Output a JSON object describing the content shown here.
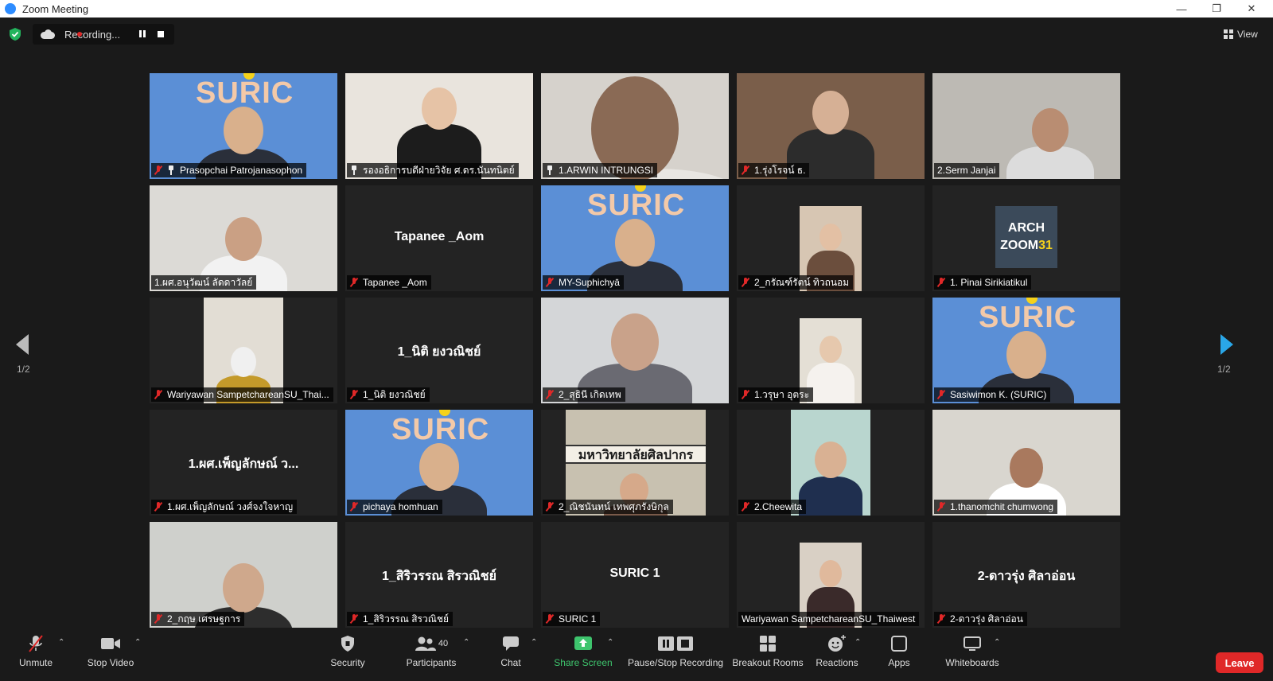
{
  "window": {
    "title": "Zoom Meeting"
  },
  "recording": {
    "status": "Recording..."
  },
  "view": {
    "label": "View"
  },
  "pagination": {
    "left": "1/2",
    "right": "1/2"
  },
  "tiles": [
    {
      "name": "Prasopchai Patrojanasophon",
      "muted": true,
      "pinned": true,
      "video": "suric"
    },
    {
      "name": "รองอธิการบดีฝ่ายวิจัย ศ.ดร.นันทนิตย์",
      "muted": false,
      "pinned": true,
      "video": "woman-light"
    },
    {
      "name": "1.ARWIN INTRUNGSI",
      "muted": false,
      "pinned": true,
      "video": "closeup",
      "active": true
    },
    {
      "name": "1.รุ่งโรจน์ ธ.",
      "muted": true,
      "pinned": false,
      "video": "bookshelf"
    },
    {
      "name": "2.Serm Janjai",
      "muted": false,
      "pinned": false,
      "video": "room"
    },
    {
      "name": "1.ผศ.อนุวัฒน์ ลัดดาวัลย์",
      "muted": false,
      "pinned": false,
      "video": "man-light"
    },
    {
      "name": "Tapanee _Aom",
      "muted": true,
      "pinned": false,
      "video": "none",
      "center": "Tapanee _Aom"
    },
    {
      "name": "MY-Suphichyā",
      "muted": true,
      "pinned": false,
      "video": "suric"
    },
    {
      "name": "2_กรัณฑ์รัตน์ ทิวถนอม",
      "muted": true,
      "pinned": false,
      "video": "portrait-small"
    },
    {
      "name": "1. Pinai Sirikiatikul",
      "muted": true,
      "pinned": false,
      "video": "arch",
      "arch_line1": "ARCH",
      "arch_line2": "ZOOM",
      "arch_num": "31"
    },
    {
      "name": "Wariyawan SampetchareanSU_Thai...",
      "muted": true,
      "pinned": false,
      "video": "portrait-mask"
    },
    {
      "name": "1_นิติ ยงวณิชย์",
      "muted": true,
      "pinned": false,
      "video": "none",
      "center": "1_นิติ ยงวณิชย์"
    },
    {
      "name": "2_สุธินี เกิดเทพ",
      "muted": true,
      "pinned": false,
      "video": "girl"
    },
    {
      "name": "1.วรุษา อุตระ",
      "muted": true,
      "pinned": false,
      "video": "portrait-white"
    },
    {
      "name": "Sasiwimon K. (SURIC)",
      "muted": true,
      "pinned": false,
      "video": "suric"
    },
    {
      "name": "1.ผศ.เพ็ญลักษณ์ วงศ์จงใจหาญ",
      "muted": true,
      "pinned": false,
      "video": "none",
      "center": "1.ผศ.เพ็ญลักษณ์ ว..."
    },
    {
      "name": "pichaya homhuan",
      "muted": true,
      "pinned": false,
      "video": "suric"
    },
    {
      "name": "2_ณิชนันทน์ เทพศุภรังษิกุล",
      "muted": true,
      "pinned": false,
      "video": "building",
      "building_text": "มหาวิทยาลัยศิลปากร"
    },
    {
      "name": "2.Cheewita",
      "muted": true,
      "pinned": false,
      "video": "portrait-blue"
    },
    {
      "name": "1.thanomchit chumwong",
      "muted": true,
      "pinned": false,
      "video": "man-white"
    },
    {
      "name": "2_กฤษ เศรษฐการ",
      "muted": true,
      "pinned": false,
      "video": "man-glasses"
    },
    {
      "name": "1_สิริวรรณ สิรวณิชย์",
      "muted": true,
      "pinned": false,
      "video": "none",
      "center": "1_สิริวรรณ สิรวณิชย์"
    },
    {
      "name": "SURIC 1",
      "muted": true,
      "pinned": false,
      "video": "none",
      "center": "SURIC 1"
    },
    {
      "name": "Wariyawan SampetchareanSU_Thaiwest",
      "muted": false,
      "pinned": false,
      "video": "portrait-woman"
    },
    {
      "name": "2-ดาวรุ่ง ศิลาอ่อน",
      "muted": true,
      "pinned": false,
      "video": "none",
      "center": "2-ดาวรุ่ง ศิลาอ่อน"
    }
  ],
  "suric_word": "SURIC",
  "toolbar": {
    "unmute": "Unmute",
    "stop_video": "Stop Video",
    "security": "Security",
    "participants": "Participants",
    "participant_count": "40",
    "chat": "Chat",
    "share_screen": "Share Screen",
    "pause_stop_recording": "Pause/Stop Recording",
    "breakout_rooms": "Breakout Rooms",
    "reactions": "Reactions",
    "apps": "Apps",
    "whiteboards": "Whiteboards",
    "leave": "Leave"
  },
  "colors": {
    "active_speaker": "#c7dc6a",
    "share_green": "#3ec46d",
    "leave_red": "#e02828",
    "suric_blue": "#5b8fd6"
  }
}
